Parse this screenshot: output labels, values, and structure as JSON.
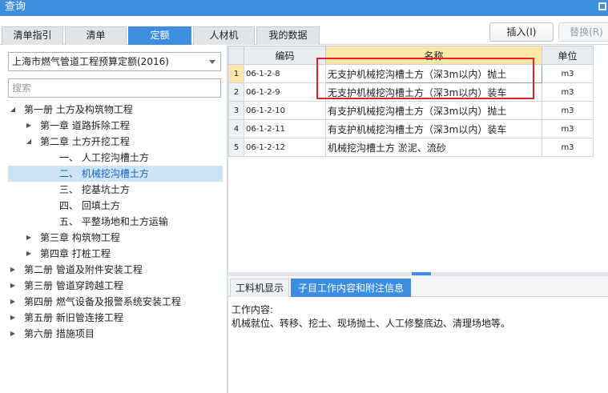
{
  "window": {
    "title": "查询"
  },
  "tabs": [
    {
      "label": "清单指引",
      "active": false
    },
    {
      "label": "清单",
      "active": false
    },
    {
      "label": "定额",
      "active": true
    },
    {
      "label": "人材机",
      "active": false
    },
    {
      "label": "我的数据",
      "active": false
    }
  ],
  "toolbar": {
    "insert_label": "插入(I)",
    "replace_label": "替换(R)"
  },
  "left": {
    "library_select": "上海市燃气管道工程预算定额(2016)",
    "search_placeholder": "搜索",
    "tree": [
      {
        "label": "第一册 土方及构筑物工程",
        "level": 0,
        "expanded": true,
        "has_children": true
      },
      {
        "label": "第一章 道路拆除工程",
        "level": 1,
        "expanded": false,
        "has_children": true
      },
      {
        "label": "第二章 土方开挖工程",
        "level": 1,
        "expanded": true,
        "has_children": true
      },
      {
        "label": "一、 人工挖沟槽土方",
        "level": 2,
        "has_children": false
      },
      {
        "label": "二、 机械挖沟槽土方",
        "level": 2,
        "has_children": false,
        "selected": true
      },
      {
        "label": "三、 挖基坑土方",
        "level": 2,
        "has_children": false
      },
      {
        "label": "四、 回填土方",
        "level": 2,
        "has_children": false
      },
      {
        "label": "五、 平整场地和土方运输",
        "level": 2,
        "has_children": false
      },
      {
        "label": "第三章 构筑物工程",
        "level": 1,
        "expanded": false,
        "has_children": true
      },
      {
        "label": "第四章 打桩工程",
        "level": 1,
        "expanded": false,
        "has_children": true
      },
      {
        "label": "第二册 管道及附件安装工程",
        "level": 0,
        "expanded": false,
        "has_children": true
      },
      {
        "label": "第三册 管道穿跨越工程",
        "level": 0,
        "expanded": false,
        "has_children": true
      },
      {
        "label": "第四册 燃气设备及报警系统安装工程",
        "level": 0,
        "expanded": false,
        "has_children": true
      },
      {
        "label": "第五册 新旧管连接工程",
        "level": 0,
        "expanded": false,
        "has_children": true
      },
      {
        "label": "第六册 措施项目",
        "level": 0,
        "expanded": false,
        "has_children": true
      }
    ]
  },
  "grid": {
    "headers": {
      "code": "编码",
      "name": "名称",
      "unit": "单位"
    },
    "rows": [
      {
        "num": "1",
        "code": "06-1-2-8",
        "name": "无支护机械挖沟槽土方（深3m以内）抛土",
        "unit": "m3"
      },
      {
        "num": "2",
        "code": "06-1-2-9",
        "name": "无支护机械挖沟槽土方（深3m以内）装车",
        "unit": "m3"
      },
      {
        "num": "3",
        "code": "06-1-2-10",
        "name": "有支护机械挖沟槽土方（深3m以内）抛土",
        "unit": "m3"
      },
      {
        "num": "4",
        "code": "06-1-2-11",
        "name": "有支护机械挖沟槽土方（深3m以内）装车",
        "unit": "m3"
      },
      {
        "num": "5",
        "code": "06-1-2-12",
        "name": "机械挖沟槽土方 淤泥、流砂",
        "unit": "m3"
      }
    ]
  },
  "bottom": {
    "tabs": [
      {
        "label": "工料机显示",
        "active": false
      },
      {
        "label": "子目工作内容和附注信息",
        "active": true
      }
    ],
    "content_title": "工作内容:",
    "content_text": "机械就位、转移、挖土、现场抛土、人工修整底边、清理场地等。"
  },
  "colors": {
    "accent": "#3d8ee0",
    "highlight": "#e0202a",
    "selected_row": "#fbe7a8"
  }
}
